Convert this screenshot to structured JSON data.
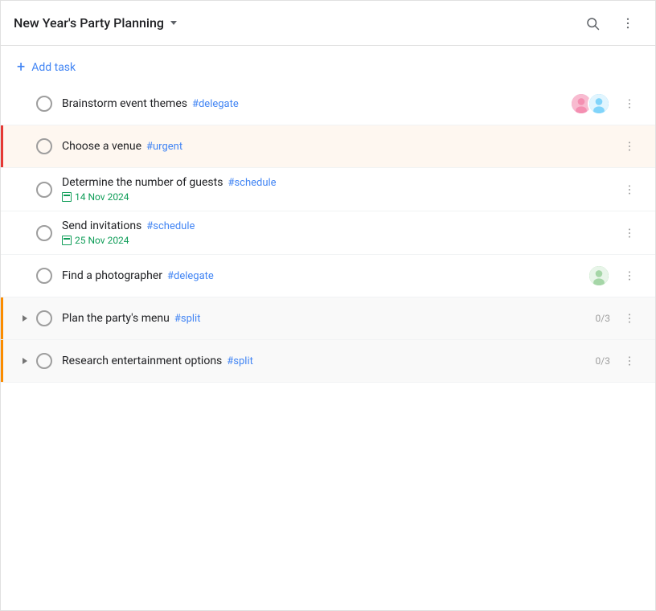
{
  "header": {
    "title": "New Year's Party Planning",
    "title_chevron": "chevron-down",
    "search_label": "search",
    "more_label": "more"
  },
  "add_task": {
    "label": "Add task",
    "plus": "+"
  },
  "tasks": [
    {
      "id": "brainstorm",
      "title": "Brainstorm event themes",
      "tag": "#delegate",
      "date": null,
      "avatars": [
        "F",
        "M"
      ],
      "count": null,
      "highlighted": false,
      "accent": null,
      "expandable": false
    },
    {
      "id": "venue",
      "title": "Choose a venue",
      "tag": "#urgent",
      "date": null,
      "avatars": [],
      "count": null,
      "highlighted": true,
      "accent": "red",
      "expandable": false
    },
    {
      "id": "guests",
      "title": "Determine the number of guests",
      "tag": "#schedule",
      "date": "14 Nov 2024",
      "avatars": [],
      "count": null,
      "highlighted": false,
      "accent": null,
      "expandable": false
    },
    {
      "id": "invitations",
      "title": "Send invitations",
      "tag": "#schedule",
      "date": "25 Nov 2024",
      "avatars": [],
      "count": null,
      "highlighted": false,
      "accent": null,
      "expandable": false
    },
    {
      "id": "photographer",
      "title": "Find a photographer",
      "tag": "#delegate",
      "date": null,
      "avatars": [
        "P"
      ],
      "count": null,
      "highlighted": false,
      "accent": null,
      "expandable": false
    },
    {
      "id": "menu",
      "title": "Plan the party's menu",
      "tag": "#split",
      "date": null,
      "avatars": [],
      "count": "0/3",
      "highlighted": false,
      "accent": "orange",
      "expandable": true
    },
    {
      "id": "entertainment",
      "title": "Research entertainment options",
      "tag": "#split",
      "date": null,
      "avatars": [],
      "count": "0/3",
      "highlighted": false,
      "accent": "orange",
      "expandable": true
    }
  ]
}
